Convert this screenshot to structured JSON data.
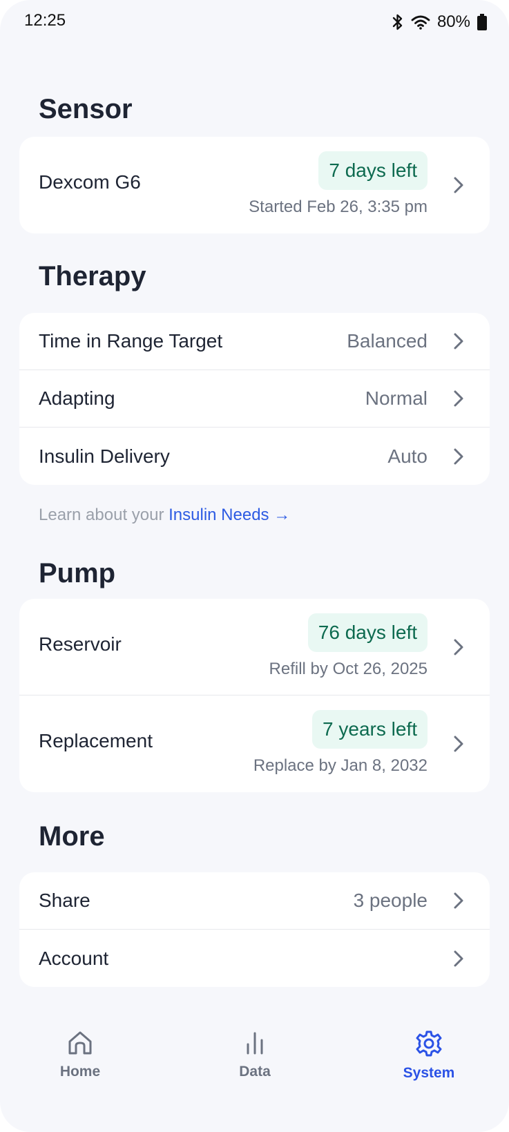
{
  "status_bar": {
    "time": "12:25",
    "battery": "80%"
  },
  "sections": {
    "sensor": {
      "title": "Sensor",
      "item": {
        "label": "Dexcom G6",
        "badge": "7 days left",
        "subtext": "Started Feb 26, 3:35 pm"
      }
    },
    "therapy": {
      "title": "Therapy",
      "rows": [
        {
          "label": "Time in Range Target",
          "value": "Balanced"
        },
        {
          "label": "Adapting",
          "value": "Normal"
        },
        {
          "label": "Insulin Delivery",
          "value": "Auto"
        }
      ],
      "learn_prefix": "Learn about your ",
      "learn_link": "Insulin Needs →"
    },
    "pump": {
      "title": "Pump",
      "rows": [
        {
          "label": "Reservoir",
          "badge": "76 days left",
          "subtext": "Refill by Oct 26, 2025"
        },
        {
          "label": "Replacement",
          "badge": "7 years left",
          "subtext": "Replace by Jan 8, 2032"
        }
      ]
    },
    "more": {
      "title": "More",
      "rows": [
        {
          "label": "Share",
          "value": "3 people"
        },
        {
          "label": "Account",
          "value": ""
        }
      ]
    }
  },
  "tabbar": {
    "tabs": [
      {
        "label": "Home",
        "icon": "home-icon"
      },
      {
        "label": "Data",
        "icon": "bar-chart-icon"
      },
      {
        "label": "System",
        "icon": "gear-icon",
        "active": true
      }
    ]
  },
  "colors": {
    "accent": "#2b52e6",
    "badge_bg": "#e9f8f3",
    "badge_text": "#0d6a4f",
    "background": "#f6f7fb"
  }
}
